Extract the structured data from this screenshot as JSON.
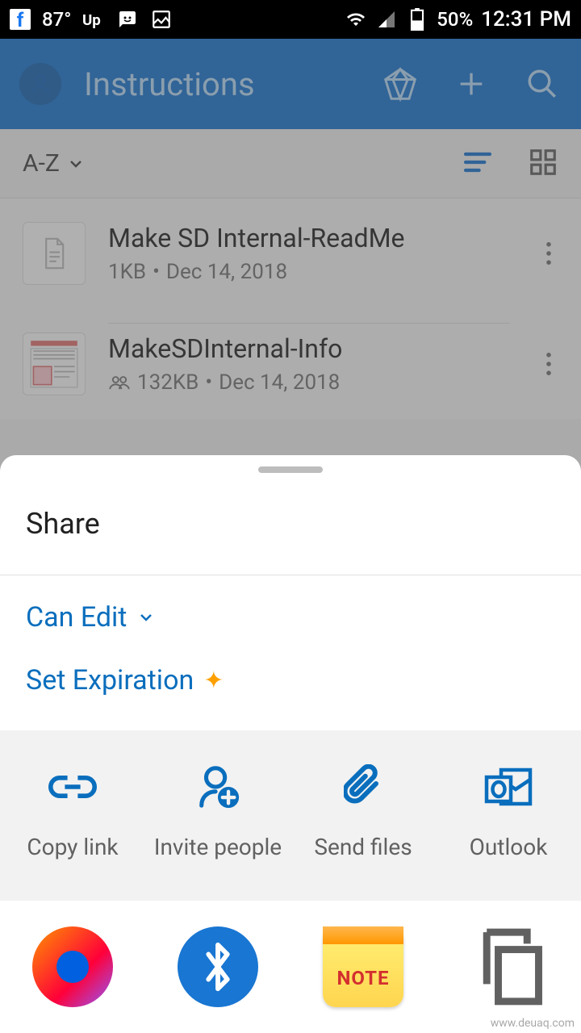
{
  "status": {
    "temperature": "87°",
    "battery": "50%",
    "time": "12:31 PM"
  },
  "header": {
    "title": "Instructions"
  },
  "sort": {
    "label": "A-Z"
  },
  "files": [
    {
      "name": "Make SD Internal-ReadMe",
      "size": "1KB",
      "date": "Dec 14, 2018",
      "shared": false
    },
    {
      "name": "MakeSDInternal-Info",
      "size": "132KB",
      "date": "Dec 14, 2018",
      "shared": true
    }
  ],
  "sheet": {
    "title": "Share",
    "permission": "Can Edit",
    "expiration": "Set Expiration",
    "actions": [
      {
        "label": "Copy link"
      },
      {
        "label": "Invite people"
      },
      {
        "label": "Send files"
      },
      {
        "label": "Outlook"
      }
    ],
    "apps": {
      "note_text": "NOTE"
    }
  },
  "watermark": "www.deuaq.com"
}
